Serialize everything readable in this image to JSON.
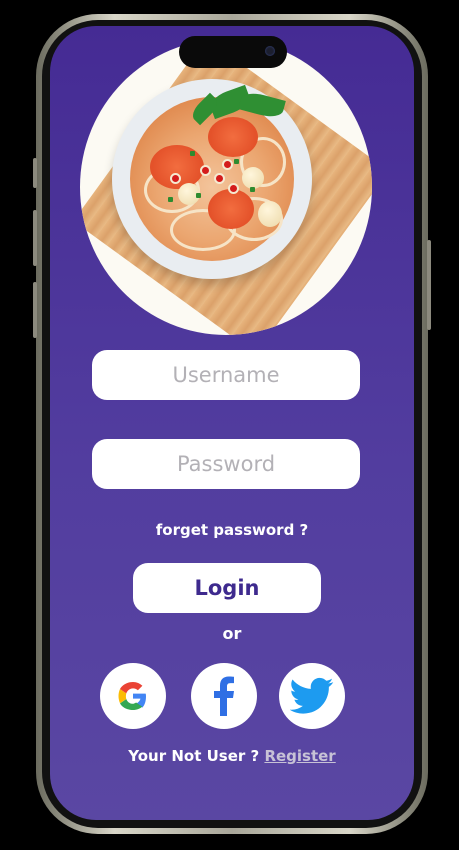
{
  "login_form": {
    "username_placeholder": "Username",
    "username_value": "",
    "password_placeholder": "Password",
    "password_value": "",
    "forgot_password_label": "forget password ?",
    "login_label": "Login",
    "or_label": "or"
  },
  "social_buttons": [
    {
      "name": "google",
      "icon": "google-icon"
    },
    {
      "name": "facebook",
      "icon": "facebook-icon"
    },
    {
      "name": "twitter",
      "icon": "twitter-icon"
    }
  ],
  "footer": {
    "prompt": "Your Not User ? ",
    "register_label": "Register"
  },
  "colors": {
    "background_top": "#452b94",
    "background_bottom": "#5a47a3",
    "login_text": "#3e2a8e",
    "facebook_blue": "#2f6fe4",
    "twitter_blue": "#1d9bf0"
  }
}
